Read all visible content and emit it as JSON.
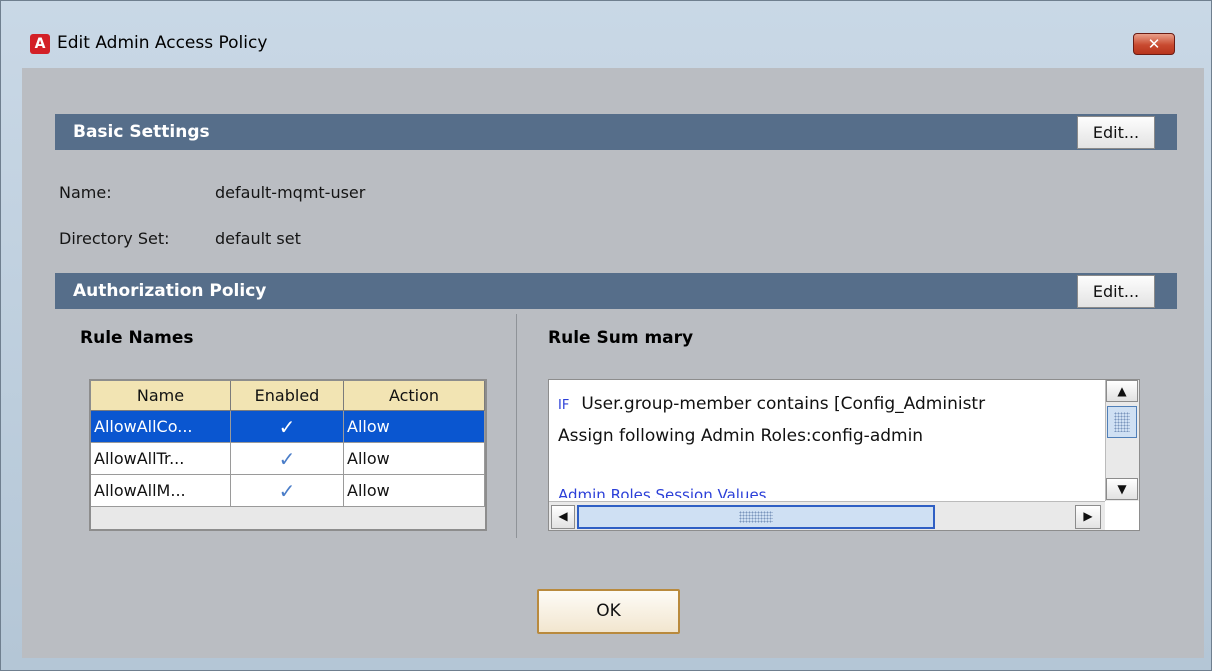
{
  "window": {
    "title": "Edit Admin Access Policy",
    "app_icon_letter": "A",
    "close_glyph": "✕"
  },
  "basic_settings": {
    "title": "Basic Settings",
    "edit_label": "Edit...",
    "name_label": "Name:",
    "name_value": "default-mqmt-user",
    "directory_label": "Directory Set:",
    "directory_value": "default set"
  },
  "authorization": {
    "title": "Authorization Policy",
    "edit_label": "Edit...",
    "rule_names_title": "Rule Names",
    "rule_summary_title": "Rule Sum mary",
    "table": {
      "columns": [
        "Name",
        "Enabled",
        "Action"
      ],
      "rows": [
        {
          "name": "AllowAllCo...",
          "enabled": "✓",
          "action": "Allow",
          "selected": true
        },
        {
          "name": "AllowAllTr...",
          "enabled": "✓",
          "action": "Allow",
          "selected": false
        },
        {
          "name": "AllowAllM...",
          "enabled": "✓",
          "action": "Allow",
          "selected": false
        }
      ]
    },
    "summary": {
      "if_keyword": "IF",
      "line1": "User.group-member contains [Config_Administr",
      "line2": "Assign following Admin Roles:config-admin",
      "line3": "Admin Roles Session Values"
    }
  },
  "footer": {
    "ok_label": "OK"
  },
  "colors": {
    "section_header": "#566e8a",
    "selection": "#0a56d0",
    "table_header": "#f2e4b3"
  }
}
